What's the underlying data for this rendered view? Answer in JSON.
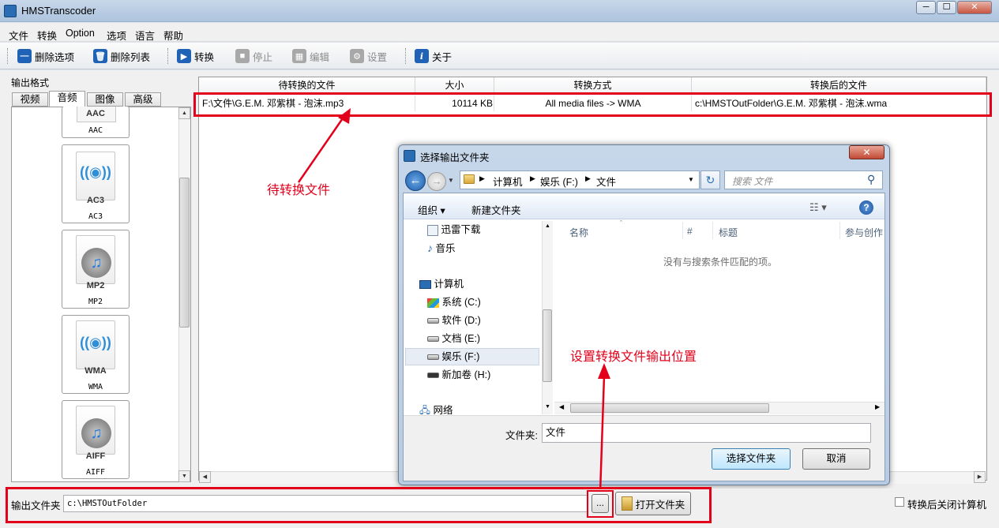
{
  "window": {
    "title": "HMSTranscoder",
    "controls": [
      "─",
      "☐",
      "✕"
    ]
  },
  "menu": [
    "文件",
    "转换",
    "Option",
    "选项",
    "语言",
    "帮助"
  ],
  "toolbar": {
    "remove_item": "删除选项",
    "remove_list": "删除列表",
    "convert": "转换",
    "stop": "停止",
    "edit": "编辑",
    "settings": "设置",
    "about": "关于"
  },
  "output_format": {
    "label": "输出格式",
    "tabs": [
      "视频",
      "音频",
      "图像",
      "高级"
    ],
    "active_tab": "音频",
    "formats": [
      {
        "label": "AAC",
        "caption": "AAC"
      },
      {
        "label": "AC3",
        "caption": "AC3"
      },
      {
        "label": "MP2",
        "caption": "MP2"
      },
      {
        "label": "WMA",
        "caption": "WMA"
      },
      {
        "label": "AIFF",
        "caption": "AIFF"
      }
    ]
  },
  "file_table": {
    "headers": [
      "待转换的文件",
      "大小",
      "转换方式",
      "转换后的文件"
    ],
    "rows": [
      {
        "source": "F:\\文件\\G.E.M. 邓紫棋 - 泡沫.mp3",
        "size": "10114 KB",
        "method": "All media files -> WMA",
        "target": "c:\\HMSTOutFolder\\G.E.M. 邓紫棋 - 泡沫.wma"
      }
    ]
  },
  "annotations": {
    "pending_file": "待转换文件",
    "set_output": "设置转换文件输出位置"
  },
  "dialog": {
    "title": "选择输出文件夹",
    "breadcrumb": [
      "计算机",
      "娱乐 (F:)",
      "文件"
    ],
    "search_placeholder": "搜索 文件",
    "organize": "组织 ▾",
    "new_folder": "新建文件夹",
    "nav": {
      "thunder_downloads": "迅雷下载",
      "music": "音乐",
      "computer": "计算机",
      "drives": [
        "系统 (C:)",
        "软件 (D:)",
        "文档 (E:)",
        "娱乐 (F:)",
        "新加卷 (H:)"
      ],
      "network": "网络"
    },
    "columns": [
      "名称",
      "#",
      "标题",
      "参与创作"
    ],
    "empty_message": "没有与搜索条件匹配的项。",
    "folder_label": "文件夹:",
    "folder_value": "文件",
    "select_button": "选择文件夹",
    "cancel_button": "取消"
  },
  "bottom_bar": {
    "output_folder_label": "输出文件夹",
    "output_folder_value": "c:\\HMSTOutFolder",
    "browse_button": "...",
    "open_folder_button": "打开文件夹",
    "shutdown_checkbox": "转换后关闭计算机"
  }
}
